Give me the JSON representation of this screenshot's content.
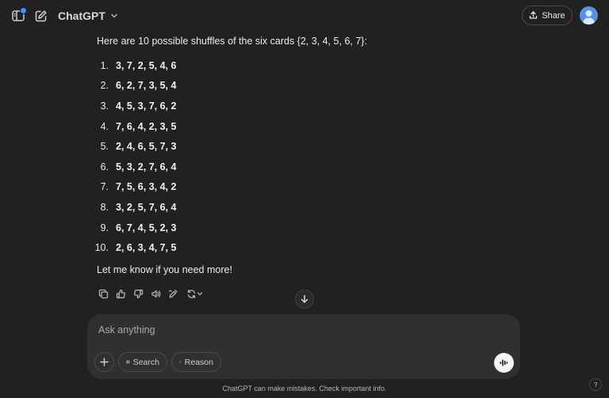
{
  "header": {
    "model_name": "ChatGPT",
    "share_label": "Share",
    "icons": [
      "sidebar-icon",
      "new-chat-icon",
      "chevron-down-icon",
      "share-icon",
      "avatar"
    ]
  },
  "message": {
    "intro": "Here are 10 possible shuffles of the six cards {2, 3, 4, 5, 6, 7}:",
    "shuffles": [
      {
        "num": "1.",
        "values": "3, 7, 2, 5, 4, 6"
      },
      {
        "num": "2.",
        "values": "6, 2, 7, 3, 5, 4"
      },
      {
        "num": "3.",
        "values": "4, 5, 3, 7, 6, 2"
      },
      {
        "num": "4.",
        "values": "7, 6, 4, 2, 3, 5"
      },
      {
        "num": "5.",
        "values": "2, 4, 6, 5, 7, 3"
      },
      {
        "num": "6.",
        "values": "5, 3, 2, 7, 6, 4"
      },
      {
        "num": "7.",
        "values": "7, 5, 6, 3, 4, 2"
      },
      {
        "num": "8.",
        "values": "3, 2, 5, 7, 6, 4"
      },
      {
        "num": "9.",
        "values": "6, 7, 4, 5, 2, 3"
      },
      {
        "num": "10.",
        "values": "2, 6, 3, 4, 7, 5"
      }
    ],
    "outro": "Let me know if you need more!"
  },
  "actions": [
    "copy-icon",
    "thumbs-up-icon",
    "thumbs-down-icon",
    "read-aloud-icon",
    "edit-canvas-icon",
    "regenerate-icon"
  ],
  "composer": {
    "placeholder": "Ask anything",
    "search_label": "Search",
    "reason_label": "Reason"
  },
  "footer": {
    "disclaimer": "ChatGPT can make mistakes. Check important info.",
    "help_label": "?"
  },
  "colors": {
    "background": "#212121",
    "composer": "#303030",
    "accent_dot": "#3e8ef7",
    "avatar": "#5b8fe6"
  }
}
